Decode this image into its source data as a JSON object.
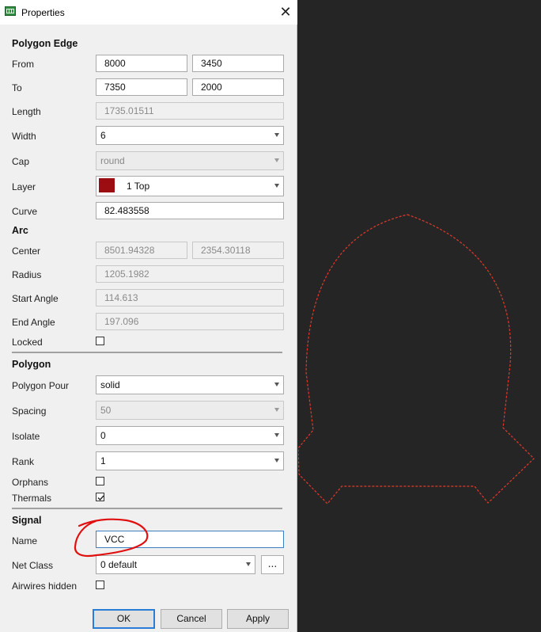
{
  "window": {
    "title": "Properties"
  },
  "sections": {
    "edge": "Polygon Edge",
    "arc": "Arc",
    "polygon": "Polygon",
    "signal": "Signal"
  },
  "labels": {
    "from": "From",
    "to": "To",
    "length": "Length",
    "width": "Width",
    "cap": "Cap",
    "layer": "Layer",
    "curve": "Curve",
    "center": "Center",
    "radius": "Radius",
    "start_angle": "Start Angle",
    "end_angle": "End Angle",
    "locked": "Locked",
    "pour": "Polygon Pour",
    "spacing": "Spacing",
    "isolate": "Isolate",
    "rank": "Rank",
    "orphans": "Orphans",
    "thermals": "Thermals",
    "name": "Name",
    "net_class": "Net Class",
    "airwires": "Airwires hidden"
  },
  "edge": {
    "from_x": "8000",
    "from_y": "3450",
    "to_x": "7350",
    "to_y": "2000",
    "length": "1735.01511",
    "width": "6",
    "cap": "round",
    "layer": "1 Top",
    "curve": "82.483558"
  },
  "arc": {
    "center_x": "8501.94328",
    "center_y": "2354.30118",
    "radius": "1205.1982",
    "start_angle": "114.613",
    "end_angle": "197.096",
    "locked": false
  },
  "polygon": {
    "pour": "solid",
    "spacing": "50",
    "isolate": "0",
    "rank": "1",
    "orphans": false,
    "thermals": true
  },
  "signal": {
    "name": "VCC",
    "net_class": "0 default",
    "more": "...",
    "airwires_hidden": false
  },
  "buttons": {
    "ok": "OK",
    "cancel": "Cancel",
    "apply": "Apply"
  },
  "colors": {
    "layer_top": "#9b0d10",
    "outline": "#e03a2a",
    "canvas_bg": "#252526",
    "annotation": "#e01010"
  }
}
